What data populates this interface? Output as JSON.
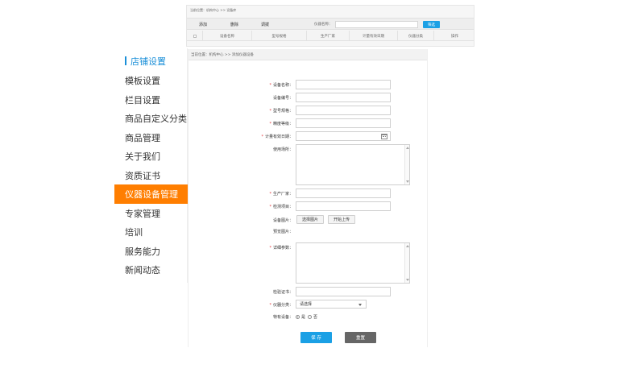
{
  "list_window": {
    "breadcrumb": "当前位置：机构中心 >> 设备库",
    "toolbar": {
      "add_label": "添加",
      "delete_label": "删除",
      "copy_label": "调拨"
    },
    "search": {
      "label": "仪器名称：",
      "value": "",
      "button_label": "筛选"
    },
    "columns": [
      "设备名称",
      "型号规格",
      "生产厂家",
      "计量有效日期",
      "仪器分类",
      "操作"
    ]
  },
  "sidebar": {
    "title": "店铺设置",
    "items": [
      {
        "label": "模板设置",
        "active": false
      },
      {
        "label": "栏目设置",
        "active": false
      },
      {
        "label": "商品自定义分类",
        "active": false
      },
      {
        "label": "商品管理",
        "active": false
      },
      {
        "label": "关于我们",
        "active": false
      },
      {
        "label": "资质证书",
        "active": false
      },
      {
        "label": "仪器设备管理",
        "active": true
      },
      {
        "label": "专家管理",
        "active": false
      },
      {
        "label": "培训",
        "active": false
      },
      {
        "label": "服务能力",
        "active": false
      },
      {
        "label": "新闻动态",
        "active": false
      }
    ]
  },
  "form_window": {
    "breadcrumb": "当前位置：机构中心 >> 添加仪器设备",
    "required_mark": "*",
    "fields": {
      "name": {
        "label": "设备名称：",
        "value": ""
      },
      "number": {
        "label": "设备编号：",
        "value": ""
      },
      "model": {
        "label": "型号规格：",
        "value": ""
      },
      "accuracy": {
        "label": "精度等级：",
        "value": ""
      },
      "valid_date": {
        "label": "计量有效日期：",
        "value": ""
      },
      "location": {
        "label": "使用场所：",
        "value": ""
      },
      "manufacturer": {
        "label": "生产厂家：",
        "value": ""
      },
      "test_item": {
        "label": "检测项目：",
        "value": ""
      },
      "photo": {
        "label": "设备图片：",
        "choose_label": "选择图片",
        "upload_label": "开始上传"
      },
      "preview": {
        "label": "预览图片："
      },
      "params": {
        "label": "详细参数：",
        "value": ""
      },
      "certificate": {
        "label": "检验证书：",
        "value": ""
      },
      "category": {
        "label": "仪器分类：",
        "selected": "请选择"
      },
      "special": {
        "label": "特有设备：",
        "yes_label": "是",
        "no_label": "否",
        "selected": "yes"
      }
    },
    "save_label": "保 存",
    "reset_label": "重置"
  },
  "colors": {
    "accent_blue": "#1ba0e5",
    "active_orange": "#ff7e00",
    "title_blue": "#1a8fd8",
    "required_red": "#e4393c"
  }
}
